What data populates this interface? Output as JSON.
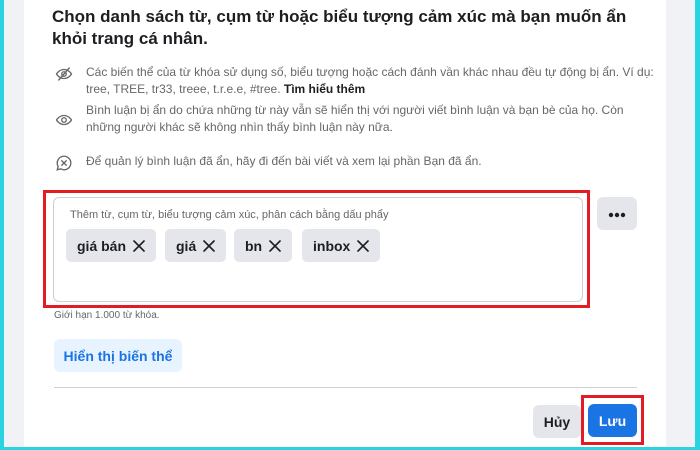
{
  "colors": {
    "primary": "#1b74e4",
    "highlight": "#e31b23",
    "secondary_bg": "#e4e6eb",
    "text_secondary": "#65676b"
  },
  "dialog": {
    "title": "Chọn danh sách từ, cụm từ hoặc biểu tượng cảm xúc mà bạn muốn ẩn khỏi trang cá nhân.",
    "info": [
      {
        "icon": "eye-slash-icon",
        "text": "Các biến thể của từ khóa sử dụng số, biểu tượng hoặc cách đánh vần khác nhau đều tự động bị ẩn. Ví dụ: tree, TREE, tr33, treee, t.r.e.e, #tree.",
        "link": "Tìm hiểu thêm"
      },
      {
        "icon": "eye-icon",
        "text": "Bình luận bị ẩn do chứa những từ này vẫn sẽ hiển thị với người viết bình luận và bạn bè của họ. Còn những người khác sẽ không nhìn thấy bình luận này nữa."
      },
      {
        "icon": "comment-x-icon",
        "text": "Để quản lý bình luận đã ẩn, hãy đi đến bài viết và xem lại phần Bạn đã ẩn."
      }
    ],
    "keyword_input": {
      "placeholder": "Thêm từ, cụm từ, biểu tượng cảm xúc, phân cách bằng dấu phẩy",
      "chips": [
        "giá bán",
        "giá",
        "bn",
        "inbox"
      ]
    },
    "limit_text": "Giới hạn 1.000 từ khóa.",
    "show_variants_label": "Hiển thị biến thể",
    "cancel_label": "Hủy",
    "save_label": "Lưu"
  }
}
